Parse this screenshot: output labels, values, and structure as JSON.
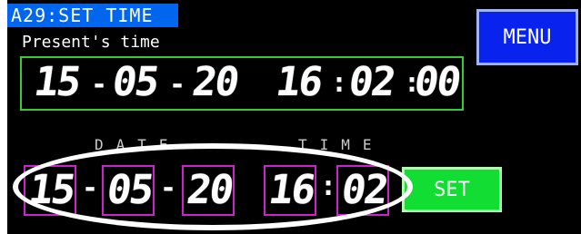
{
  "title": "A29:SET TIME",
  "present_label": "Present's time",
  "present": {
    "year": "15",
    "month": "05",
    "day": "20",
    "hour": "16",
    "minute": "02",
    "second": "00",
    "sep_date": "-",
    "sep_time": ":"
  },
  "menu_label": "MENU",
  "set_caption_date": "DATE",
  "set_caption_time": "TIME",
  "set": {
    "year": "15",
    "month": "05",
    "day": "20",
    "hour": "16",
    "minute": "02",
    "sep_date": "-",
    "sep_time": ":"
  },
  "set_button_label": "SET",
  "colors": {
    "title_bg": "#0066ee",
    "present_frame": "#33cc33",
    "input_frame": "#cc22cc",
    "menu_bg": "#0a22ee",
    "set_bg": "#11dd33"
  }
}
